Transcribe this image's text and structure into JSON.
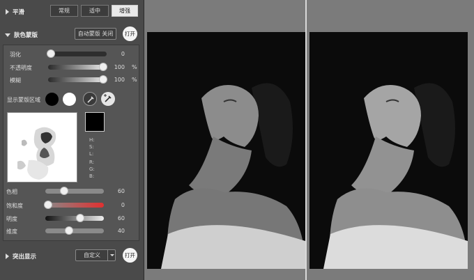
{
  "smooth": {
    "title": "平滑",
    "modes": [
      "常规",
      "适中",
      "增强"
    ],
    "active_mode": "增强"
  },
  "skin_mask": {
    "title": "肤色蒙版",
    "auto_mask_button": "自动蒙版 关闭",
    "open_label": "打开",
    "feather": {
      "label": "羽化",
      "value": "0"
    },
    "opacity": {
      "label": "不透明度",
      "value": "100",
      "unit": "%"
    },
    "blur": {
      "label": "模糊",
      "value": "100",
      "unit": "%"
    },
    "show_mask_label": "显示蒙版区域",
    "channel_labels": [
      "H:",
      "S:",
      "L:",
      "R:",
      "G:",
      "B:"
    ],
    "hue": {
      "label": "色相",
      "value": "60"
    },
    "saturation": {
      "label": "饱和度",
      "value": "0"
    },
    "lightness": {
      "label": "明度",
      "value": "60"
    },
    "latitude": {
      "label": "维度",
      "value": "40"
    }
  },
  "highlight": {
    "title": "突出显示",
    "dropdown_value": "自定义",
    "open_label": "打开"
  },
  "colors": {
    "panel_bg": "#4a4a4a",
    "viewer_bg": "#7b7b7b",
    "saturation_red": "#e03030"
  }
}
